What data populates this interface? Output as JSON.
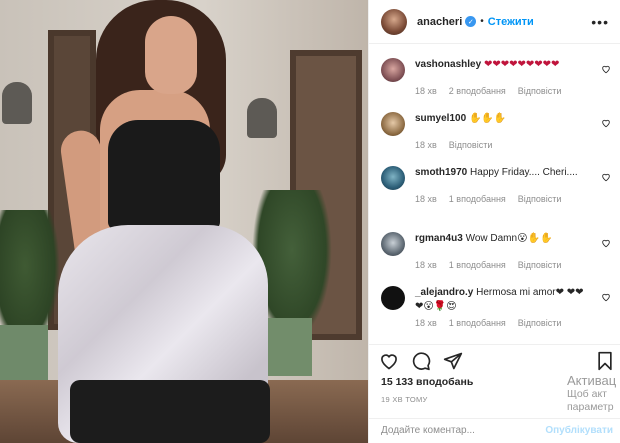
{
  "post": {
    "username": "anacheri",
    "follow_label": "Стежити",
    "more_label": "•••"
  },
  "comments": [
    {
      "username": "vashonashley",
      "text": "❤❤❤❤❤❤❤❤❤",
      "time": "18 хв",
      "likes": "2 вподобання",
      "reply": "Відповісти"
    },
    {
      "username": "sumyel100",
      "text": "✋✋✋",
      "time": "18 хв",
      "likes": "",
      "reply": "Відповісти"
    },
    {
      "username": "smoth1970",
      "text": "Happy Friday.... Cheri....",
      "time": "18 хв",
      "likes": "1 вподобання",
      "reply": "Відповісти"
    },
    {
      "username": "rgman4u3",
      "text": "Wow Damn😮✋✋",
      "time": "18 хв",
      "likes": "1 вподобання",
      "reply": "Відповісти"
    },
    {
      "username": "_alejandro.y",
      "text": "Hermosa mi amor❤ ❤❤❤😮🌹😍",
      "time": "18 хв",
      "likes": "1 вподобання",
      "reply": "Відповісти"
    }
  ],
  "likes_count": "15 133 вподобань",
  "timestamp": "19 ХВ ТОМУ",
  "add_comment": {
    "placeholder": "Додайте коментар...",
    "publish_label": "Опублікувати"
  },
  "watermark": {
    "line1": "Активац",
    "line2": "Щоб акт",
    "line3": "параметр"
  }
}
